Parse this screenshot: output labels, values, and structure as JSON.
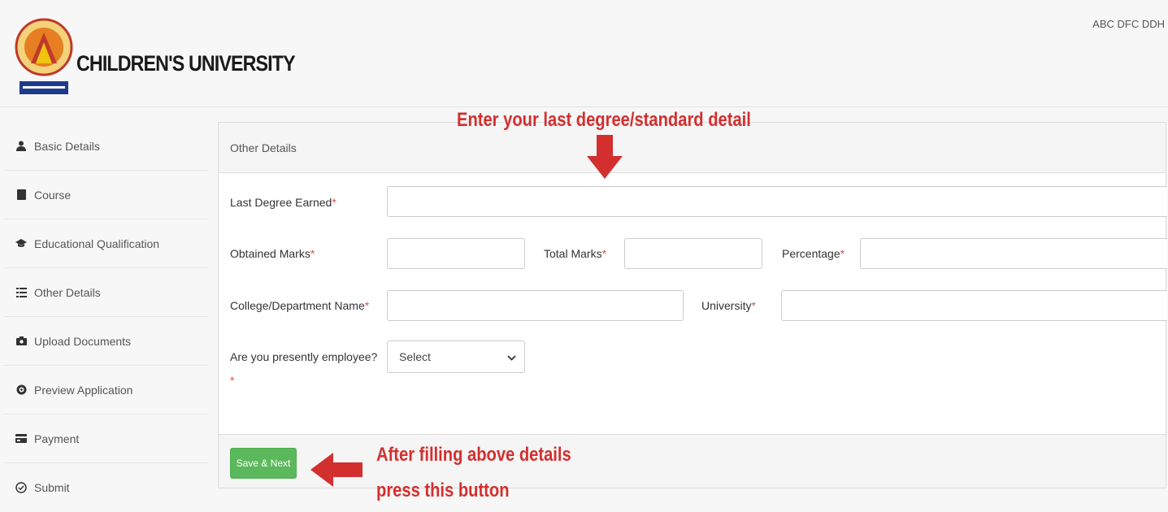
{
  "header": {
    "brand": "CHILDREN'S UNIVERSITY",
    "user": "ABC DFC DDH"
  },
  "sidebar": {
    "items": [
      {
        "label": "Basic Details",
        "icon": "user-icon"
      },
      {
        "label": "Course",
        "icon": "book-icon"
      },
      {
        "label": "Educational Qualification",
        "icon": "graduation-cap-icon"
      },
      {
        "label": "Other Details",
        "icon": "list-icon"
      },
      {
        "label": "Upload Documents",
        "icon": "camera-icon"
      },
      {
        "label": "Preview Application",
        "icon": "eye-icon"
      },
      {
        "label": "Payment",
        "icon": "card-icon"
      },
      {
        "label": "Submit",
        "icon": "check-circle-icon"
      }
    ]
  },
  "panel": {
    "title": "Other Details",
    "fields": {
      "last_degree": {
        "label": "Last Degree Earned",
        "value": ""
      },
      "obtained_marks": {
        "label": "Obtained Marks",
        "value": ""
      },
      "total_marks": {
        "label": "Total Marks",
        "value": ""
      },
      "percentage": {
        "label": "Percentage",
        "value": ""
      },
      "college": {
        "label": "College/Department Name",
        "value": ""
      },
      "university": {
        "label": "University",
        "value": ""
      },
      "employee": {
        "label": "Are you presently employee?",
        "selected": "Select"
      }
    },
    "required_mark": "*",
    "save_label": "Save & Next"
  },
  "annotations": {
    "top": "Enter your last degree/standard detail",
    "bottom_line1": "After filling above details",
    "bottom_line2": "press this button"
  },
  "colors": {
    "accent_green": "#5cb85c",
    "annotation_red": "#d32f2f",
    "required_red": "#d9534f"
  }
}
